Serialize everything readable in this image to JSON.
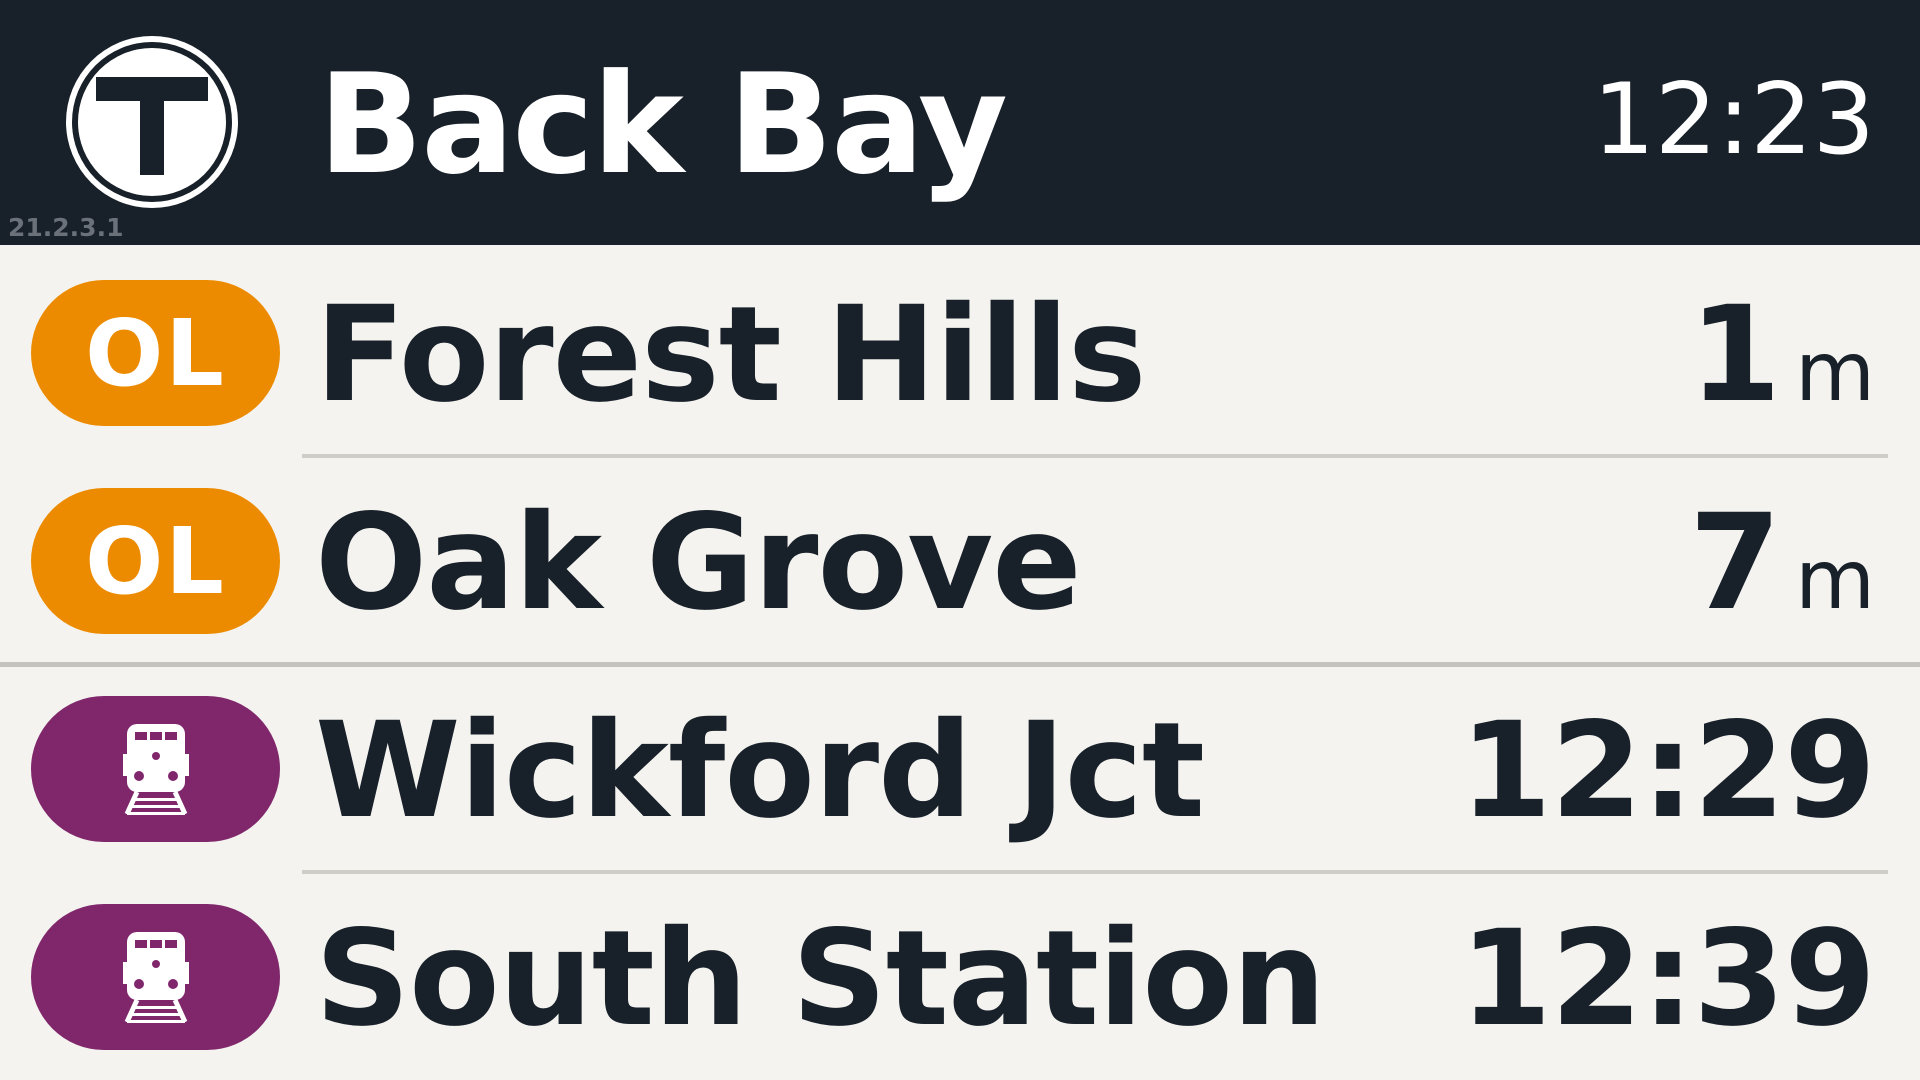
{
  "header": {
    "station_name": "Back Bay",
    "clock": "12:23",
    "version": "21.2.3.1",
    "logo_letter": "T",
    "background_color": "#18202a"
  },
  "departures": [
    {
      "route_label": "OL",
      "route_type": "orange-line",
      "route_color": "#ed8b00",
      "destination": "Forest Hills",
      "time_value": "1",
      "time_unit": "m"
    },
    {
      "route_label": "OL",
      "route_type": "orange-line",
      "route_color": "#ed8b00",
      "destination": "Oak Grove",
      "time_value": "7",
      "time_unit": "m"
    },
    {
      "route_icon": "commuter-rail-train-icon",
      "route_type": "commuter-rail",
      "route_color": "#80276c",
      "destination": "Wickford Jct",
      "time_clock": "12:29"
    },
    {
      "route_icon": "commuter-rail-train-icon",
      "route_type": "commuter-rail",
      "route_color": "#80276c",
      "destination": "South Station",
      "time_clock": "12:39"
    }
  ]
}
